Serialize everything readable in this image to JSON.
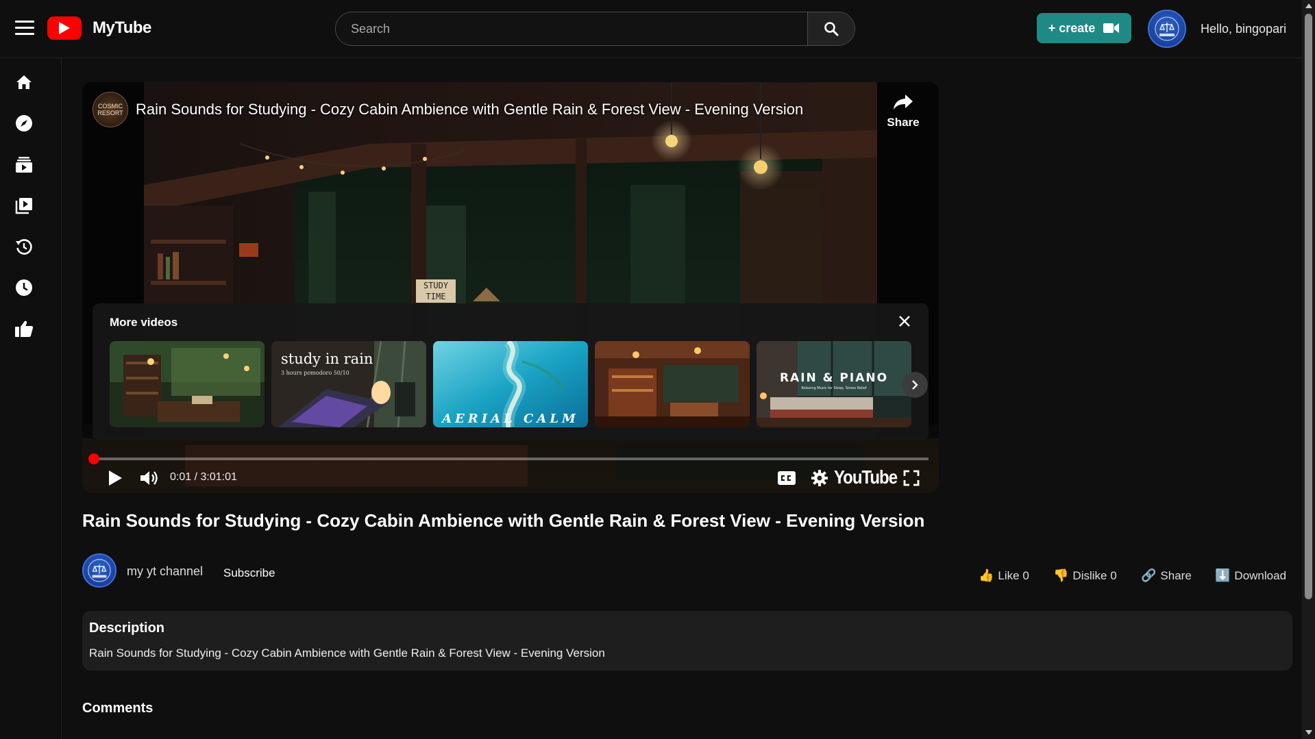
{
  "app": {
    "name": "MyTube"
  },
  "header": {
    "search_placeholder": "Search",
    "create_label": "+ create",
    "greeting": "Hello, bingopari"
  },
  "sidebar": {
    "items": [
      {
        "icon": "home-icon"
      },
      {
        "icon": "compass-icon"
      },
      {
        "icon": "subscriptions-icon"
      },
      {
        "icon": "library-icon"
      },
      {
        "icon": "history-icon"
      },
      {
        "icon": "watch-later-icon"
      },
      {
        "icon": "liked-videos-icon"
      }
    ]
  },
  "player": {
    "channel_avatar_text": "COSMIC RESORT",
    "overlay_title": "Rain Sounds for Studying - Cozy Cabin Ambience with Gentle Rain & Forest View - Evening Version",
    "share_label": "Share",
    "more_videos_label": "More videos",
    "thumbnails": [
      {
        "text": "",
        "sub": ""
      },
      {
        "text": "study in rain",
        "sub": "3 hours pomodoro 50/10"
      },
      {
        "text": "AERIAL CALM",
        "sub": ""
      },
      {
        "text": "",
        "sub": ""
      },
      {
        "text": "RAIN & PIANO",
        "sub": "Relaxing Music for Sleep, Stress Relief"
      }
    ],
    "time_display": "0:01 / 3:01:01",
    "progress_fraction": 0.0001,
    "brand_word": "YouTube",
    "scene_sign": "STUDY TIME"
  },
  "video": {
    "title": "Rain Sounds for Studying - Cozy Cabin Ambience with Gentle Rain & Forest View - Evening Version",
    "channel_name": "my yt channel",
    "subscribe_label": "Subscribe",
    "like_label": "Like 0",
    "dislike_label": "Dislike 0",
    "share_label": "Share",
    "download_label": "Download"
  },
  "description": {
    "heading": "Description",
    "text": "Rain Sounds for Studying - Cozy Cabin Ambience with Gentle Rain & Forest View - Evening Version"
  },
  "comments": {
    "heading": "Comments"
  },
  "colors": {
    "background": "#0f0f0f",
    "brand_red": "#ff0000",
    "create_button": "#1f8a85",
    "panel": "#1e1e1e"
  }
}
